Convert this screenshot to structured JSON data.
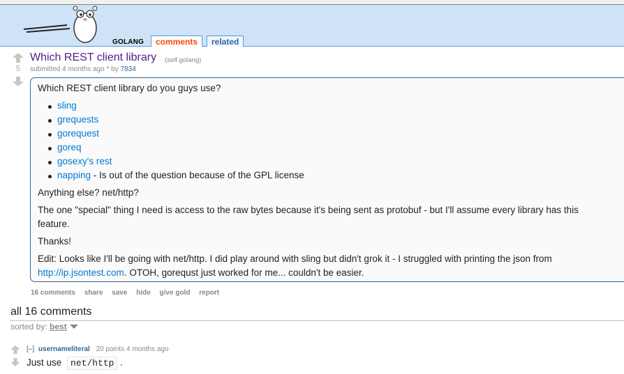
{
  "header": {
    "subreddit": "GOLANG",
    "tabs": {
      "comments": "comments",
      "related": "related"
    }
  },
  "post": {
    "score": "5",
    "title": "Which REST client library",
    "domain": "(self.golang)",
    "tagline_prefix": "submitted 4 months ago * by",
    "author": "7834",
    "body": {
      "intro": "Which REST client library do you guys use?",
      "list": [
        {
          "link": "sling",
          "rest": ""
        },
        {
          "link": "grequests",
          "rest": ""
        },
        {
          "link": "gorequest",
          "rest": ""
        },
        {
          "link": "goreq",
          "rest": ""
        },
        {
          "link": "gosexy's rest",
          "rest": ""
        },
        {
          "link": "napping",
          "rest": " - Is out of the question because of the GPL license"
        }
      ],
      "anything_else": "Anything else? net/http?",
      "special_1": "The one \"special\" thing I need is access to the raw bytes because it's being sent as protobuf - but I'll assume every library has this",
      "special_2": "feature.",
      "thanks": "Thanks!",
      "edit_1": "Edit: Looks like I'll be going with net/http. I did play around with sling but didn't grok it - I struggled with printing the json from",
      "edit_link": "http://ip.jsontest.com",
      "edit_2": ". OTOH, gorequst just worked for me... couldn't be easier."
    },
    "buttons": {
      "comments": "16 comments",
      "share": "share",
      "save": "save",
      "hide": "hide",
      "give_gold": "give gold",
      "report": "report"
    }
  },
  "comments_area": {
    "title": "all 16 comments",
    "sorted_by_label": "sorted by:",
    "sorted_by_value": "best"
  },
  "comment": {
    "toggle": "[–]",
    "user": "usernameliteral",
    "meta": "20 points 4 months ago",
    "text": "Just use",
    "code": "net/http",
    "suffix": "."
  },
  "colors": {
    "header_bg": "#cee3f8",
    "link": "#0079d3",
    "title_visited": "#551a8b",
    "active_tab": "#ff4500"
  }
}
